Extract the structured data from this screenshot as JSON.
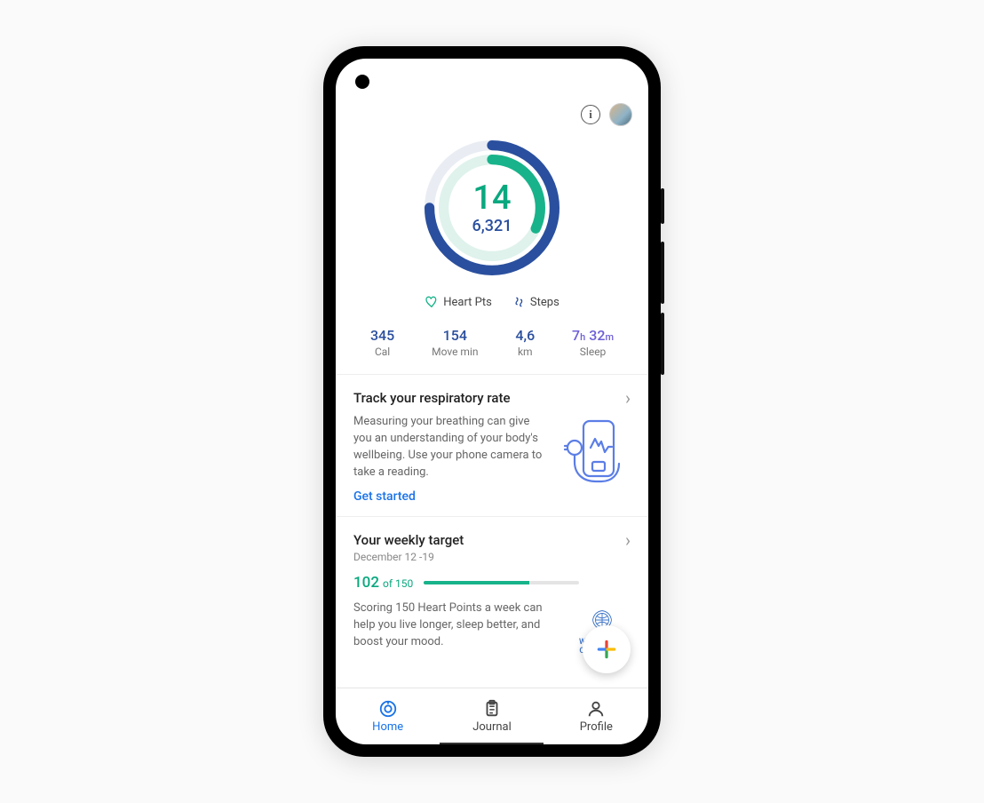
{
  "colors": {
    "teal": "#18b38a",
    "blue": "#2a4f9e",
    "link": "#1a73e8",
    "sleep": "#6d5fd6"
  },
  "header": {
    "info_icon_label": "i"
  },
  "rings": {
    "heart_points": "14",
    "steps": "6,321",
    "hp_progress_pct": 32,
    "steps_progress_pct": 75
  },
  "legend": {
    "heart": "Heart Pts",
    "steps": "Steps"
  },
  "stats": [
    {
      "value": "345",
      "label": "Cal",
      "kind": "cal"
    },
    {
      "value": "154",
      "label": "Move min",
      "kind": "move"
    },
    {
      "value": "4,6",
      "label": "km",
      "kind": "km"
    },
    {
      "value": "7h 32m",
      "label": "Sleep",
      "kind": "sleep"
    }
  ],
  "card_resp": {
    "title": "Track your respiratory rate",
    "text": "Measuring your breathing can give you an understanding of your body's wellbeing. Use your phone camera to take a reading.",
    "link": "Get started"
  },
  "card_weekly": {
    "title": "Your weekly target",
    "date_range": "December 12 -19",
    "current": "102",
    "of_total": "of 150",
    "progress_pct": 68,
    "text": "Scoring 150 Heart Points a week can help you live longer, sleep better, and boost your mood.",
    "who_label_1": "World Health",
    "who_label_2": "Organization"
  },
  "nav": {
    "home": "Home",
    "journal": "Journal",
    "profile": "Profile",
    "active": "home"
  }
}
